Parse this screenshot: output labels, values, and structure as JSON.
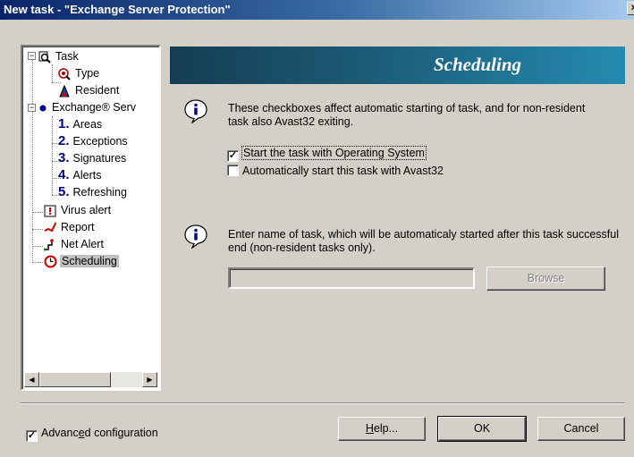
{
  "window": {
    "title": "New task - \"Exchange Server Protection\"",
    "close_symbol": "×"
  },
  "tree": {
    "items": [
      {
        "label": "Task",
        "icon": "task-search-icon"
      },
      {
        "label": "Type",
        "icon": "type-icon"
      },
      {
        "label": "Resident",
        "icon": "resident-icon"
      },
      {
        "label": "Exchange® Serv",
        "icon": "exchange-dot-icon"
      },
      {
        "label": "Areas",
        "number": "1."
      },
      {
        "label": "Exceptions",
        "number": "2."
      },
      {
        "label": "Signatures",
        "number": "3."
      },
      {
        "label": "Alerts",
        "number": "4."
      },
      {
        "label": "Refreshing",
        "number": "5."
      },
      {
        "label": "Virus alert",
        "icon": "virus-alert-icon"
      },
      {
        "label": "Report",
        "icon": "report-icon"
      },
      {
        "label": "Net Alert",
        "icon": "net-alert-icon"
      },
      {
        "label": "Scheduling",
        "icon": "scheduling-clock-icon",
        "selected": true
      }
    ],
    "expander_minus": "−"
  },
  "panel": {
    "title": "Scheduling",
    "info1": "These checkboxes affect automatic starting of task, and for non-resident task also Avast32 exiting.",
    "checkbox_os": {
      "label": "Start the task with Operating System",
      "checked": true
    },
    "checkbox_avast": {
      "label": "Automatically start this task with Avast32",
      "checked": false
    },
    "info2": "Enter name of task, which will be automaticaly started after this task successful end (non-resident tasks only).",
    "task_name_value": "",
    "browse_label": "Browse"
  },
  "footer": {
    "advanced": {
      "label_pre": "Advanc",
      "label_u": "e",
      "label_post": "d configuration",
      "checked": true
    },
    "help_u": "H",
    "help_rest": "elp...",
    "ok_label": "OK",
    "cancel_label": "Cancel"
  },
  "check_mark": "✓"
}
